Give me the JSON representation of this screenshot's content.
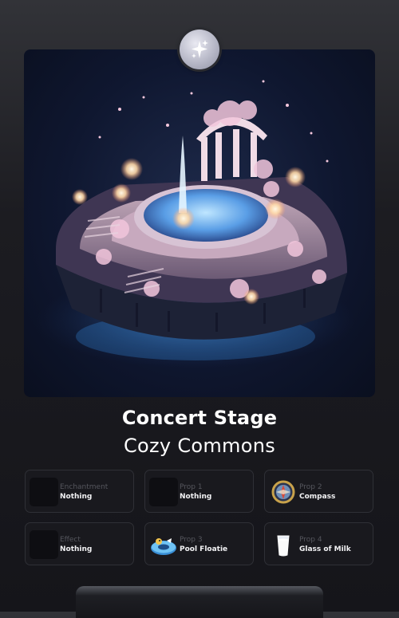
{
  "card": {
    "title": "Concert Stage",
    "subtitle": "Cozy Commons",
    "badge_icon": "sparkles-icon",
    "image": "floating-island-fountain-stage"
  },
  "slots": [
    {
      "label": "Enchantment",
      "value": "Nothing",
      "icon": "empty-slot"
    },
    {
      "label": "Prop 1",
      "value": "Nothing",
      "icon": "empty-slot"
    },
    {
      "label": "Prop 2",
      "value": "Compass",
      "icon": "compass-icon"
    },
    {
      "label": "Effect",
      "value": "Nothing",
      "icon": "empty-slot"
    },
    {
      "label": "Prop 3",
      "value": "Pool Floatie",
      "icon": "pool-floatie-icon"
    },
    {
      "label": "Prop 4",
      "value": "Glass of Milk",
      "icon": "glass-of-milk-icon"
    }
  ],
  "colors": {
    "background": "#1c1c21",
    "slot_border": "#2f3036",
    "label_text": "#55565d",
    "value_text": "#f2f2f4"
  }
}
